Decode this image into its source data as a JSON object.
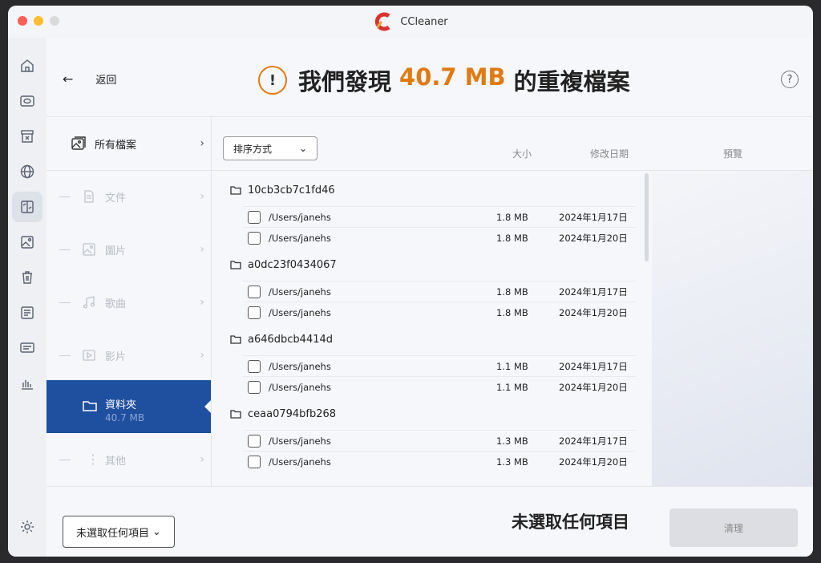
{
  "window": {
    "title": "CCleaner"
  },
  "header": {
    "back_label": "返回",
    "headline_prefix": "我們發現",
    "headline_amount": "40.7 MB",
    "headline_suffix": "的重複檔案",
    "help_glyph": "?"
  },
  "sidebar_rail": {
    "icons": [
      "home-icon",
      "disk-icon",
      "archive-icon",
      "globe-icon",
      "duplicate-files-icon",
      "image-icon",
      "trash-icon",
      "list-icon",
      "monitor-icon",
      "chart-icon"
    ],
    "active": "duplicate-files-icon",
    "settings_icon": "gear-icon"
  },
  "categories": {
    "all": {
      "label": "所有檔案"
    },
    "items": [
      {
        "label": "文件",
        "icon": "document-icon"
      },
      {
        "label": "圖片",
        "icon": "image-icon"
      },
      {
        "label": "歌曲",
        "icon": "music-icon"
      },
      {
        "label": "影片",
        "icon": "video-icon"
      }
    ],
    "active": {
      "label": "資料夾",
      "sub": "40.7 MB",
      "icon": "folder-icon"
    },
    "other": {
      "label": "其他",
      "icon": "more-icon"
    }
  },
  "list": {
    "sort_label": "排序方式",
    "columns": {
      "size": "大小",
      "date": "修改日期",
      "preview": "預覽"
    },
    "groups": [
      {
        "name": "10cb3cb7c1fd46",
        "rows": [
          {
            "path": "/Users/janehs",
            "size": "1.8 MB",
            "date": "2024年1月17日"
          },
          {
            "path": "/Users/janehs",
            "size": "1.8 MB",
            "date": "2024年1月20日"
          }
        ]
      },
      {
        "name": "a0dc23f0434067",
        "rows": [
          {
            "path": "/Users/janehs",
            "size": "1.8 MB",
            "date": "2024年1月17日"
          },
          {
            "path": "/Users/janehs",
            "size": "1.8 MB",
            "date": "2024年1月20日"
          }
        ]
      },
      {
        "name": "a646dbcb4414d",
        "rows": [
          {
            "path": "/Users/janehs",
            "size": "1.1 MB",
            "date": "2024年1月17日"
          },
          {
            "path": "/Users/janehs",
            "size": "1.1 MB",
            "date": "2024年1月20日"
          }
        ]
      },
      {
        "name": "ceaa0794bfb268",
        "rows": [
          {
            "path": "/Users/janehs",
            "size": "1.3 MB",
            "date": "2024年1月17日"
          },
          {
            "path": "/Users/janehs",
            "size": "1.3 MB",
            "date": "2024年1月20日"
          }
        ]
      }
    ]
  },
  "footer": {
    "selection_dropdown": "未選取任何項目",
    "message": "未選取任何項目",
    "clean_label": "清理"
  },
  "colors": {
    "accent": "#e07a10",
    "active_category": "#1f4f9f"
  }
}
